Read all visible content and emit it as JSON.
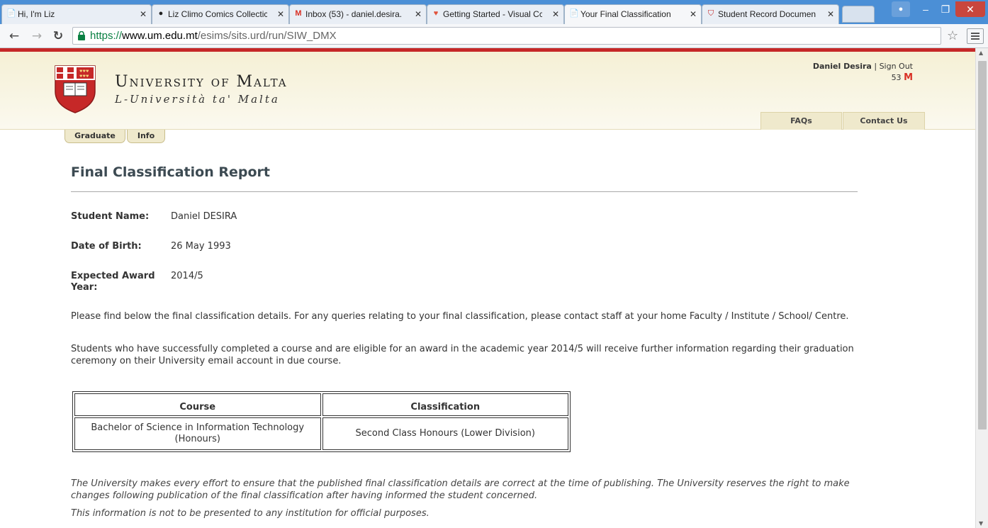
{
  "browser": {
    "tabs": [
      {
        "title": "Hi, I'm Liz",
        "icon": "page-icon"
      },
      {
        "title": "Liz Climo Comics Collectic",
        "icon": "tumblr-icon"
      },
      {
        "title": "Inbox (53) - daniel.desira.",
        "icon": "gmail-icon"
      },
      {
        "title": "Getting Started - Visual Cc",
        "icon": "heart-icon"
      },
      {
        "title": "Your Final Classification",
        "icon": "page-icon"
      },
      {
        "title": "Student Record Documen",
        "icon": "crest-icon"
      }
    ],
    "active_tab": 4,
    "url_scheme": "https://",
    "url_host": "www.um.edu.mt",
    "url_path": "/esims/sits.urd/run/SIW_DMX",
    "accent": "#4b8fd6"
  },
  "header": {
    "university_name": "University of Malta",
    "university_subtitle": "L-Università ta' Malta",
    "user_name": "Daniel Desira",
    "separator": "|",
    "sign_out": "Sign Out",
    "mail_count": "53",
    "links": [
      "FAQs",
      "Contact Us"
    ],
    "subtabs": [
      "Graduate",
      "Info"
    ],
    "brand_red": "#c62828"
  },
  "report": {
    "title": "Final Classification Report",
    "fields": [
      {
        "label": "Student Name:",
        "value": "Daniel DESIRA"
      },
      {
        "label": "Date of Birth:",
        "value": "26 May 1993"
      },
      {
        "label": "Expected Award Year:",
        "value": "2014/5"
      }
    ],
    "intro_1": "Please find below the final classification details. For any queries relating to your final classification, please contact staff at your home Faculty / Institute / School/ Centre.",
    "intro_2": "Students who have successfully completed a course and are eligible for an award in the academic year 2014/5 will receive further information regarding their graduation ceremony on their University email account in due course.",
    "table": {
      "headers": [
        "Course",
        "Classification"
      ],
      "rows": [
        [
          "Bachelor of Science in Information Technology (Honours)",
          "Second Class Honours (Lower Division)"
        ]
      ]
    },
    "disclaimer": "The University makes every effort to ensure that the published final classification details are correct at the time of publishing. The University reserves the right to make changes following publication of the final classification after having informed the student concerned.",
    "official_note": "This information is not to be presented to any institution for official purposes."
  }
}
